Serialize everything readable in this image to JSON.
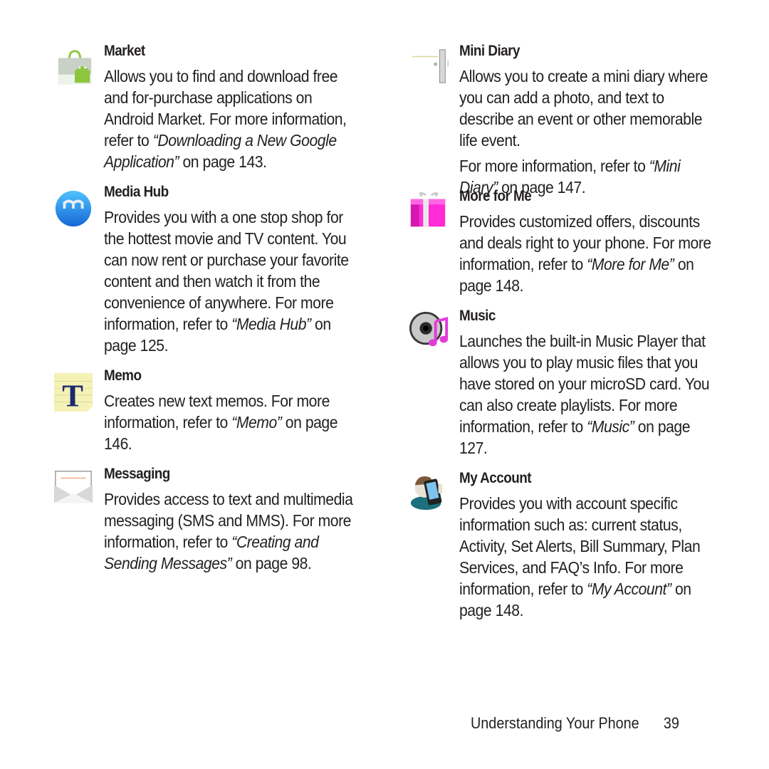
{
  "entries": [
    {
      "title": "Market",
      "icon": "market-bag-icon",
      "pre": "Allows you to find and download free and for-purchase applications on Android Market. For more information, refer to ",
      "ref": "“Downloading a New Google Application”",
      "post": " on page 143."
    },
    {
      "title": "Media Hub",
      "icon": "media-hub-icon",
      "pre": "Provides you with a one stop shop for the hottest movie and TV content. You can now rent or purchase your favorite content and then watch it from the convenience of anywhere. For more information, refer to ",
      "ref": "“Media Hub”",
      "post": " on page 125."
    },
    {
      "title": "Memo",
      "icon": "memo-icon",
      "pre": "Creates new text memos. For more information, refer to ",
      "ref": "“Memo”",
      "post": " on page 146."
    },
    {
      "title": "Messaging",
      "icon": "messaging-envelope-icon",
      "pre": "Provides access to text and multimedia messaging (SMS and MMS). For more information, refer to ",
      "ref": "“Creating and Sending Messages”",
      "post": " on page 98."
    },
    {
      "title": "Mini Diary",
      "icon": "mini-diary-icon",
      "intro": "Allows you to create a mini diary where you can add a photo, and text to describe an event or other memorable life event.",
      "pre": "For more information, refer to ",
      "ref": "“Mini Diary”",
      "post": " on page 147."
    },
    {
      "title": "More for Me",
      "icon": "gift-box-icon",
      "pre": "Provides customized offers, discounts and deals right to your phone. For more information, refer to ",
      "ref": "“More for Me”",
      "post": " on page 148."
    },
    {
      "title": "Music",
      "icon": "music-disc-icon",
      "pre": "Launches the built-in Music Player that allows you to play music files that you have stored on your microSD card. You can also create playlists. For more information, refer to ",
      "ref": "“Music”",
      "post": " on page 127."
    },
    {
      "title": "My Account",
      "icon": "my-account-icon",
      "pre": "Provides you with account specific information such as: current status, Activity, Set Alerts, Bill Summary, Plan Services, and FAQ’s Info. For more information, refer to ",
      "ref": "“My Account”",
      "post": " on page 148."
    }
  ],
  "footer": {
    "section": "Understanding Your Phone",
    "page_number": "39"
  },
  "colors": {
    "text": "#231f20",
    "android_green": "#8cc63f",
    "media_blue": "#1e90e8",
    "gift_pink": "#ff2bd6",
    "memo_blue": "#1b2a6b"
  }
}
